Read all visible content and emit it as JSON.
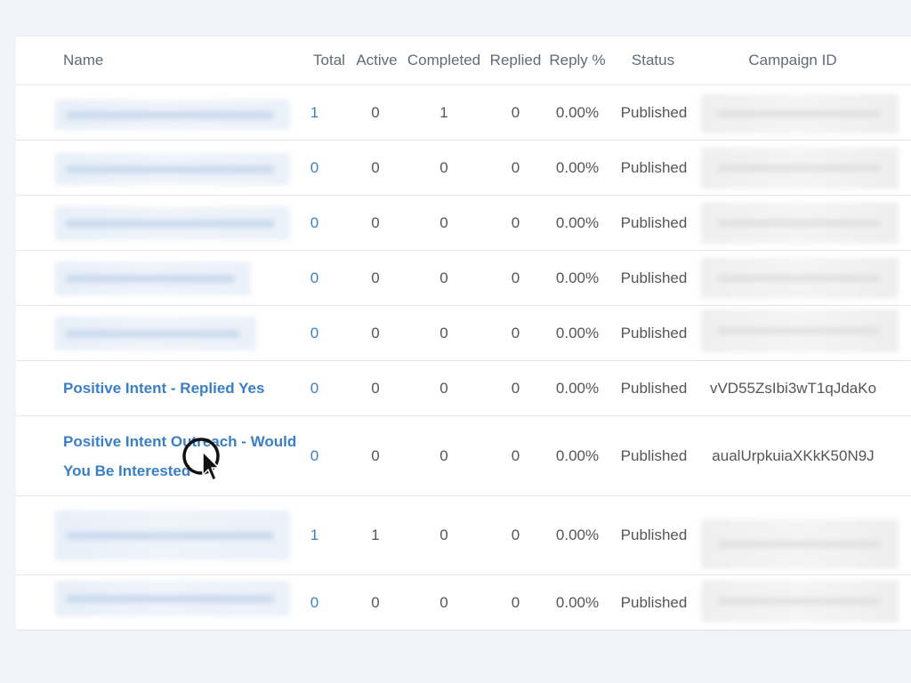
{
  "table": {
    "headers": {
      "name": "Name",
      "total": "Total",
      "active": "Active",
      "completed": "Completed",
      "replied": "Replied",
      "reply_pct": "Reply %",
      "status": "Status",
      "campaign_id": "Campaign ID"
    },
    "rows": [
      {
        "name": "",
        "total": "1",
        "active": "0",
        "completed": "1",
        "replied": "0",
        "reply_pct": "0.00%",
        "status": "Published",
        "campaign_id": ""
      },
      {
        "name": "",
        "total": "0",
        "active": "0",
        "completed": "0",
        "replied": "0",
        "reply_pct": "0.00%",
        "status": "Published",
        "campaign_id": ""
      },
      {
        "name": "",
        "total": "0",
        "active": "0",
        "completed": "0",
        "replied": "0",
        "reply_pct": "0.00%",
        "status": "Published",
        "campaign_id": ""
      },
      {
        "name": "",
        "total": "0",
        "active": "0",
        "completed": "0",
        "replied": "0",
        "reply_pct": "0.00%",
        "status": "Published",
        "campaign_id": ""
      },
      {
        "name": "",
        "total": "0",
        "active": "0",
        "completed": "0",
        "replied": "0",
        "reply_pct": "0.00%",
        "status": "Published",
        "campaign_id": ""
      },
      {
        "name": "Positive Intent - Replied Yes",
        "total": "0",
        "active": "0",
        "completed": "0",
        "replied": "0",
        "reply_pct": "0.00%",
        "status": "Published",
        "campaign_id": "vVD55ZsIbi3wT1qJdaKo"
      },
      {
        "name": "Positive Intent Outreach - Would You Be Interested",
        "total": "0",
        "active": "0",
        "completed": "0",
        "replied": "0",
        "reply_pct": "0.00%",
        "status": "Published",
        "campaign_id": "aualUrpkuiaXKkK50N9J"
      },
      {
        "name": "",
        "total": "1",
        "active": "1",
        "completed": "0",
        "replied": "0",
        "reply_pct": "0.00%",
        "status": "Published",
        "campaign_id": ""
      },
      {
        "name": "",
        "total": "0",
        "active": "0",
        "completed": "0",
        "replied": "0",
        "reply_pct": "0.00%",
        "status": "Published",
        "campaign_id": ""
      }
    ]
  },
  "colors": {
    "background": "#f1f5f9",
    "link": "#3a7fc6",
    "text": "#555555",
    "header_text": "#5f6b77"
  },
  "icons": {
    "cursor": "mouse-pointer-icon"
  }
}
